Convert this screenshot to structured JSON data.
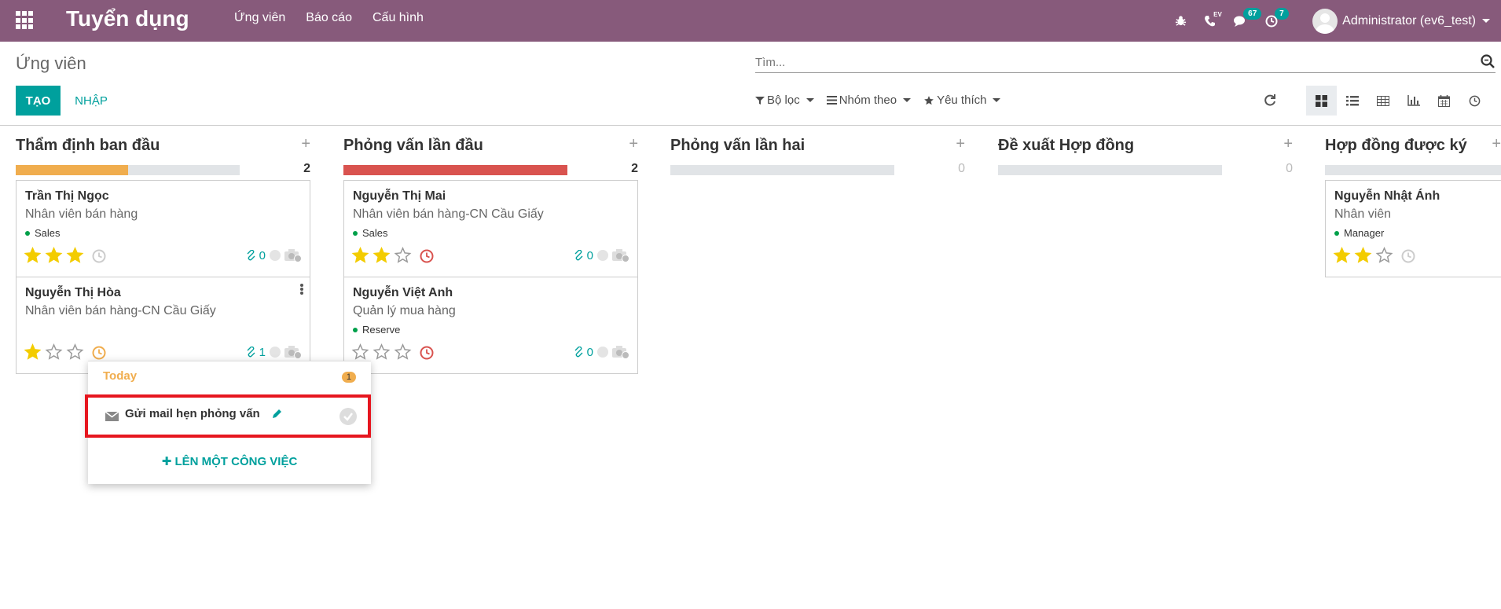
{
  "navbar": {
    "app_title": "Tuyển dụng",
    "menu": [
      "Ứng viên",
      "Báo cáo",
      "Cấu hình"
    ],
    "phone_label": "EV",
    "messages_badge": "67",
    "activities_badge": "7",
    "user_name": "Administrator (ev6_test)",
    "bg_color": "#875a7b"
  },
  "control_panel": {
    "breadcrumb": "Ứng viên",
    "create_label": "TẠO",
    "import_label": "NHẬP",
    "search_placeholder": "Tìm...",
    "filter_label": "Bộ lọc",
    "groupby_label": "Nhóm theo",
    "favorites_label": "Yêu thích",
    "accent_color": "#00a09d"
  },
  "columns": [
    {
      "title": "Thẩm định ban đầu",
      "count": "2",
      "progress": 0.5,
      "progress_color": "#f0ad4e",
      "cards": [
        {
          "name": "Trần Thị Ngọc",
          "job": "Nhân viên bán hàng",
          "tag": "Sales",
          "stars": 3,
          "attachments": "0",
          "activity_state": "none"
        },
        {
          "name": "Nguyễn Thị Hòa",
          "job": "Nhân viên bán hàng-CN Cầu Giấy",
          "tag": "",
          "stars": 1,
          "attachments": "1",
          "activity_state": "today"
        }
      ]
    },
    {
      "title": "Phỏng vấn lần đầu",
      "count": "2",
      "progress": 1.0,
      "progress_color": "#d9534f",
      "cards": [
        {
          "name": "Nguyễn Thị Mai",
          "job": "Nhân viên bán hàng-CN Cầu Giấy",
          "tag": "Sales",
          "stars": 2,
          "attachments": "0",
          "activity_state": "overdue"
        },
        {
          "name": "Nguyễn Việt Anh",
          "job": "Quản lý mua hàng",
          "tag": "Reserve",
          "stars": 0,
          "attachments": "0",
          "activity_state": "overdue"
        }
      ]
    },
    {
      "title": "Phỏng vấn lần hai",
      "count": "0",
      "progress": 0,
      "progress_color": "#e1e4e7",
      "cards": []
    },
    {
      "title": "Đề xuất Hợp đồng",
      "count": "0",
      "progress": 0,
      "progress_color": "#e1e4e7",
      "cards": []
    },
    {
      "title": "Hợp đồng được ký",
      "count": "",
      "progress": 0,
      "progress_color": "#e1e4e7",
      "cards": [
        {
          "name": "Nguyễn Nhật Ánh",
          "job": "Nhân viên",
          "tag": "Manager",
          "stars": 2,
          "attachments": "",
          "activity_state": "none"
        }
      ]
    }
  ],
  "activity_popup": {
    "section_label": "Today",
    "section_count": "1",
    "activity_name": "Gửi mail hẹn phỏng vấn",
    "schedule_label": "LÊN MỘT CÔNG VIỆC"
  }
}
